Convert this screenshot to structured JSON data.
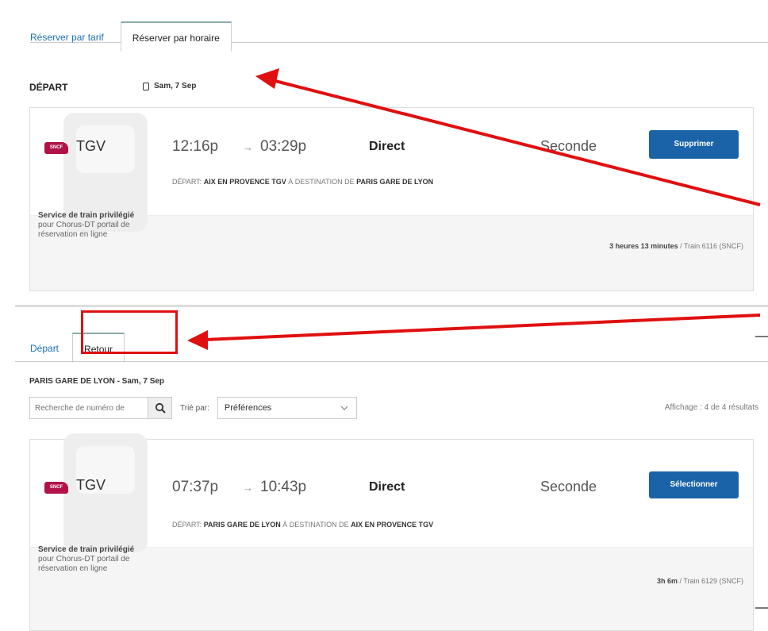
{
  "top_tabs": [
    {
      "label": "Réserver par tarif",
      "active": false
    },
    {
      "label": "Réserver par horaire",
      "active": true
    }
  ],
  "outbound": {
    "heading": "DÉPART",
    "date": "Sam, 7 Sep",
    "train": {
      "operator_logo": "SNCF",
      "type": "TGV",
      "depart_time": "12:16p",
      "arrow": "→",
      "arrive_time": "03:29p",
      "stops": "Direct",
      "class": "Seconde",
      "action_label": "Supprimer",
      "route_prefix": "DÉPART:",
      "origin": "AIX EN PROVENCE TGV",
      "route_mid": "À DESTINATION DE",
      "destination": "PARIS GARE DE LYON",
      "service_bold": "Service de train privilégié",
      "service_rest": "pour Chorus-DT portail de réservation en ligne",
      "duration_bold": "3 heures 13 minutes",
      "duration_rest": "/ Train 6116 (SNCF)"
    }
  },
  "return_tabs": [
    {
      "label": "Départ",
      "active": false
    },
    {
      "label": "Retour",
      "active": true
    }
  ],
  "return_section": {
    "station_date": "PARIS GARE DE LYON - Sam, 7 Sep",
    "search_placeholder": "Recherche de numéro de",
    "sort_label": "Trié par:",
    "sort_value": "Préférences",
    "results_text": "Affichage : 4 de 4 résultats",
    "train": {
      "operator_logo": "SNCF",
      "type": "TGV",
      "depart_time": "07:37p",
      "arrow": "→",
      "arrive_time": "10:43p",
      "stops": "Direct",
      "class": "Seconde",
      "action_label": "Sélectionner",
      "route_prefix": "DÉPART:",
      "origin": "PARIS GARE DE LYON",
      "route_mid": "À DESTINATION DE",
      "destination": "AIX EN PROVENCE TGV",
      "service_bold": "Service de train privilégié",
      "service_rest": "pour Chorus-DT portail de réservation en ligne",
      "duration_bold": "3h 6m",
      "duration_rest": "/ Train 6129 (SNCF)"
    }
  },
  "colors": {
    "accent": "#1a63a8",
    "annotation": "#e01010",
    "sncf": "#b1124a"
  }
}
